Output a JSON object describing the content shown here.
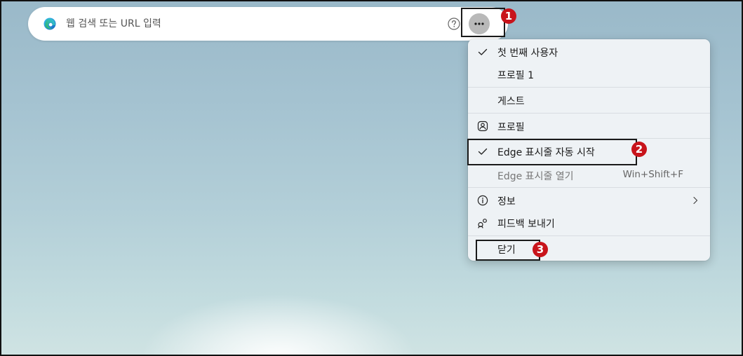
{
  "search": {
    "placeholder": "웹 검색 또는 URL 입력"
  },
  "icons": {
    "browser_logo": "edge-logo-icon",
    "help": "question-mark-icon",
    "more": "more-dots-icon",
    "check": "checkmark-icon",
    "profile": "profile-badge-icon",
    "info": "info-icon",
    "feedback": "feedback-icon",
    "submenu": "chevron-right-icon"
  },
  "menu": {
    "profile_current": "첫 번째 사용자",
    "profile_1": "프로필 1",
    "guest": "게스트",
    "profile": "프로필",
    "startup_boost": "Edge 표시줄 자동 시작",
    "open_bar": "Edge 표시줄 열기",
    "open_bar_shortcut": "Win+Shift+F",
    "info": "정보",
    "feedback": "피드백 보내기",
    "close": "닫기"
  },
  "annotations": {
    "step1": "1",
    "step2": "2",
    "step3": "3"
  },
  "colors": {
    "badge": "#c8141b",
    "more_button": "#b9b9b9",
    "menu_bg": "#eef2f5"
  }
}
